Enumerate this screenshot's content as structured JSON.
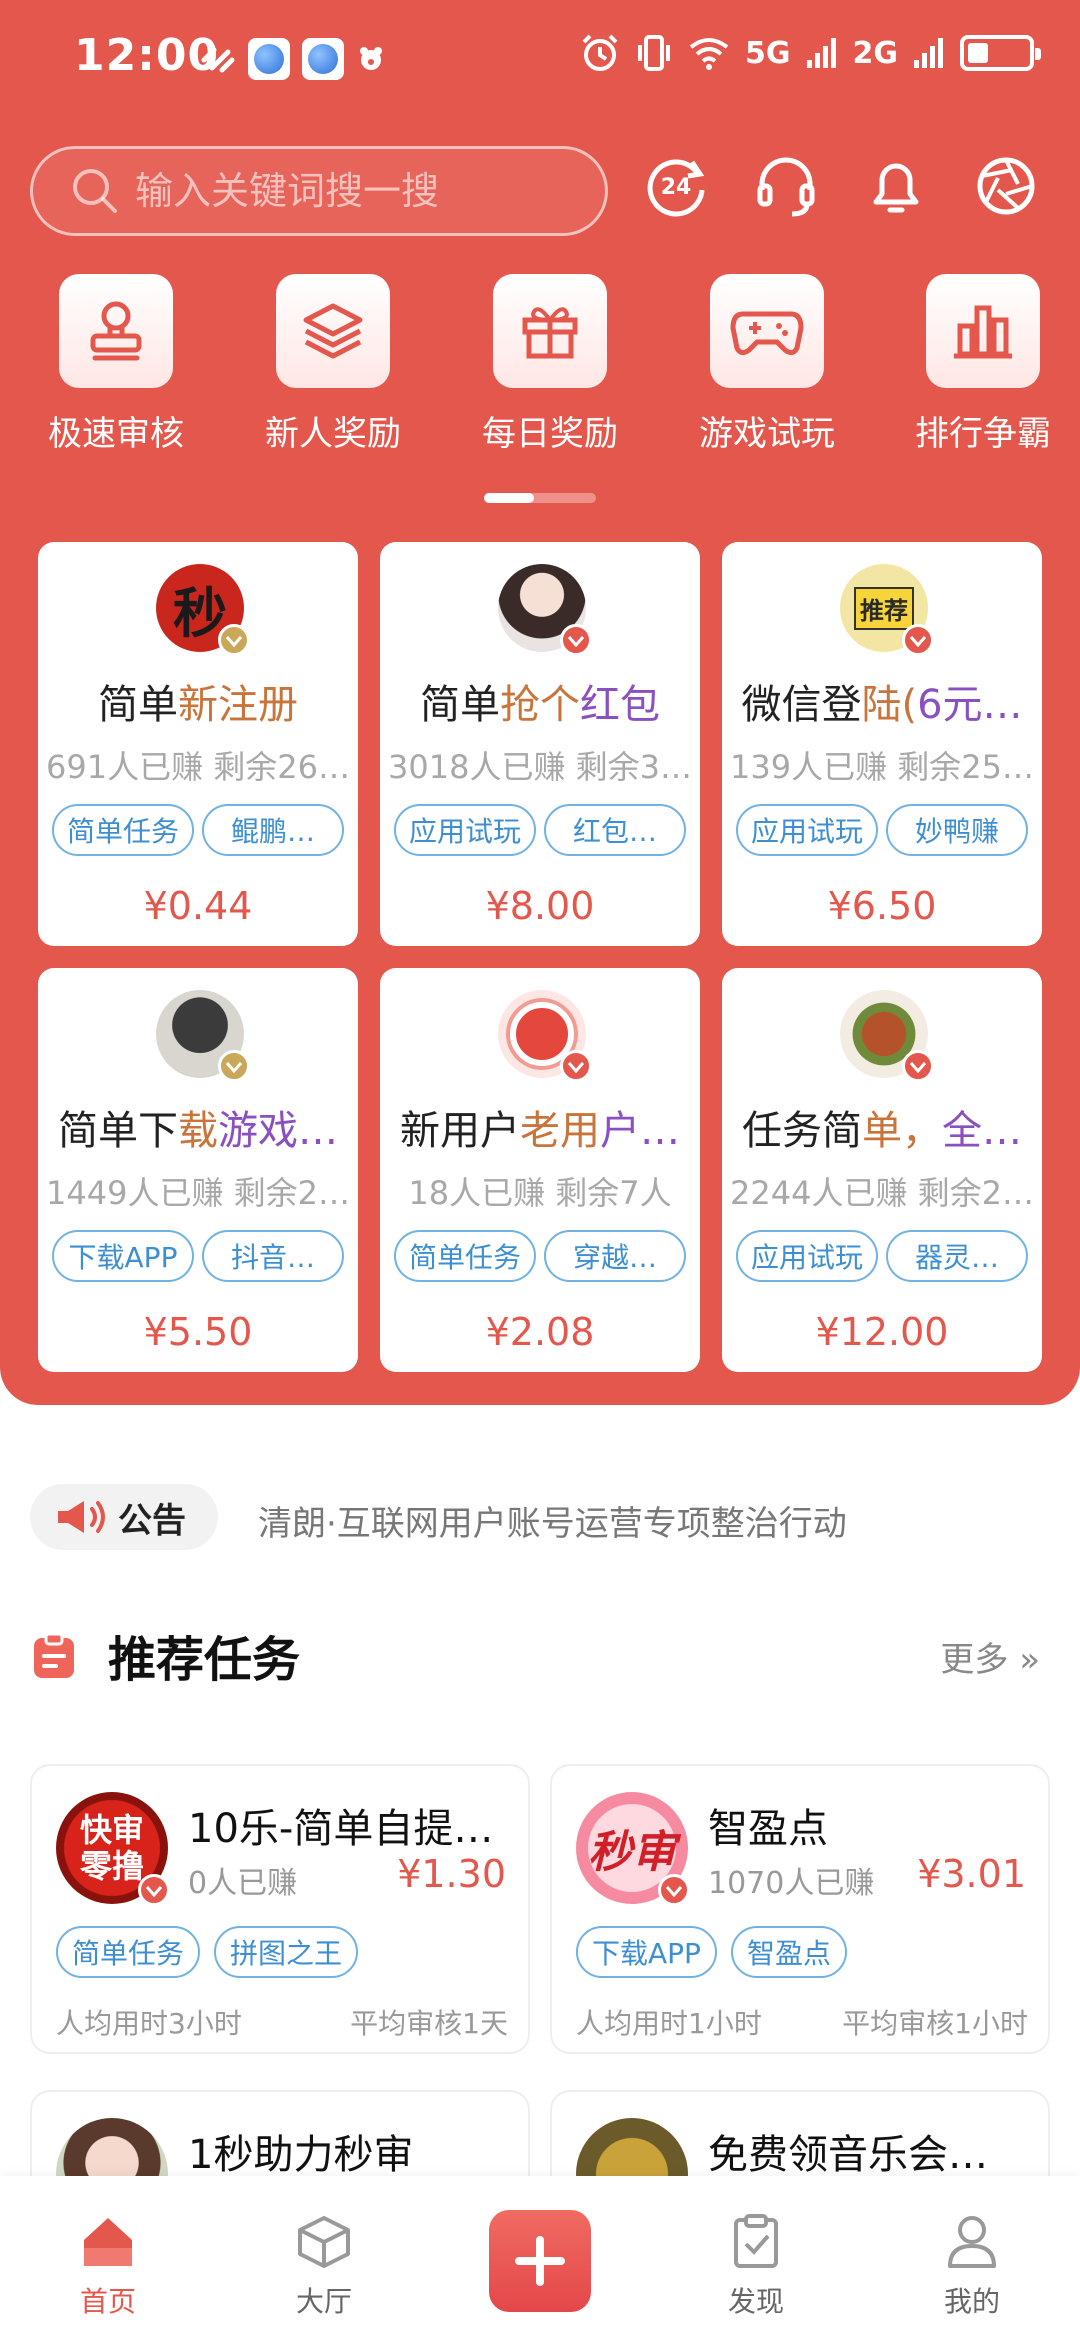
{
  "status_bar": {
    "time": "12:00",
    "net1": "5G",
    "net2": "2G"
  },
  "search": {
    "placeholder": "输入关键词搜一搜"
  },
  "categories": [
    {
      "label": "极速审核",
      "icon": "stamp-icon"
    },
    {
      "label": "新人奖励",
      "icon": "layers-icon"
    },
    {
      "label": "每日奖励",
      "icon": "gift-icon"
    },
    {
      "label": "游戏试玩",
      "icon": "gamepad-icon"
    },
    {
      "label": "排行争霸",
      "icon": "bar-chart-icon"
    }
  ],
  "cards": [
    {
      "title_a": "简单",
      "title_b": "新注册",
      "title_c": "",
      "earned": "691人已赚",
      "remain": "剩余26…",
      "tag1": "简单任务",
      "tag2": "鲲鹏…",
      "price": "¥0.44",
      "avatar_text": "秒"
    },
    {
      "title_a": "简单",
      "title_b": "抢个",
      "title_c": "红包",
      "earned": "3018人已赚",
      "remain": "剩余3…",
      "tag1": "应用试玩",
      "tag2": "红包…",
      "price": "¥8.00",
      "avatar_text": ""
    },
    {
      "title_a": "微信登",
      "title_b": "陆(",
      "title_c": "6元…",
      "earned": "139人已赚",
      "remain": "剩余25…",
      "tag1": "应用试玩",
      "tag2": "妙鸭赚",
      "price": "¥6.50",
      "avatar_text": "推荐"
    },
    {
      "title_a": "简单下",
      "title_b": "载",
      "title_c": "游戏…",
      "earned": "1449人已赚",
      "remain": "剩余2…",
      "tag1": "下载APP",
      "tag2": "抖音…",
      "price": "¥5.50",
      "avatar_text": ""
    },
    {
      "title_a": "新用户",
      "title_b": "老用",
      "title_c": "户…",
      "earned": "18人已赚",
      "remain": "剩余7人",
      "tag1": "简单任务",
      "tag2": "穿越…",
      "price": "¥2.08",
      "avatar_text": ""
    },
    {
      "title_a": "任务简",
      "title_b": "单，",
      "title_c": "全…",
      "earned": "2244人已赚",
      "remain": "剩余2…",
      "tag1": "应用试玩",
      "tag2": "器灵…",
      "price": "¥12.00",
      "avatar_text": ""
    }
  ],
  "notice": {
    "label": "公告",
    "text": "清朗·互联网用户账号运营专项整治行动"
  },
  "section": {
    "title": "推荐任务",
    "more": "更多"
  },
  "recommend": [
    {
      "title": "10乐-简单自提…",
      "earned": "0人已赚",
      "price": "¥1.30",
      "tag1": "简单任务",
      "tag2": "拼图之王",
      "time": "人均用时3小时",
      "review": "平均审核1天",
      "avatar_text": "快审零撸"
    },
    {
      "title": "智盈点",
      "earned": "1070人已赚",
      "price": "¥3.01",
      "tag1": "下载APP",
      "tag2": "智盈点",
      "time": "人均用时1小时",
      "review": "平均审核1小时",
      "avatar_text": "秒审"
    },
    {
      "title": "1秒助力秒审"
    },
    {
      "title": "免费领音乐会…"
    }
  ],
  "nav": [
    {
      "label": "首页",
      "icon": "home-icon"
    },
    {
      "label": "大厅",
      "icon": "cube-icon"
    },
    {
      "label": "",
      "icon": "plus-icon"
    },
    {
      "label": "发现",
      "icon": "clipboard-check-icon"
    },
    {
      "label": "我的",
      "icon": "user-icon"
    }
  ],
  "colors": {
    "primary": "#e4574c",
    "tag_border": "#6fb2e3",
    "tag_text": "#3e8fd1",
    "title_orange": "#c8743a",
    "title_purple": "#8a4fc2"
  }
}
